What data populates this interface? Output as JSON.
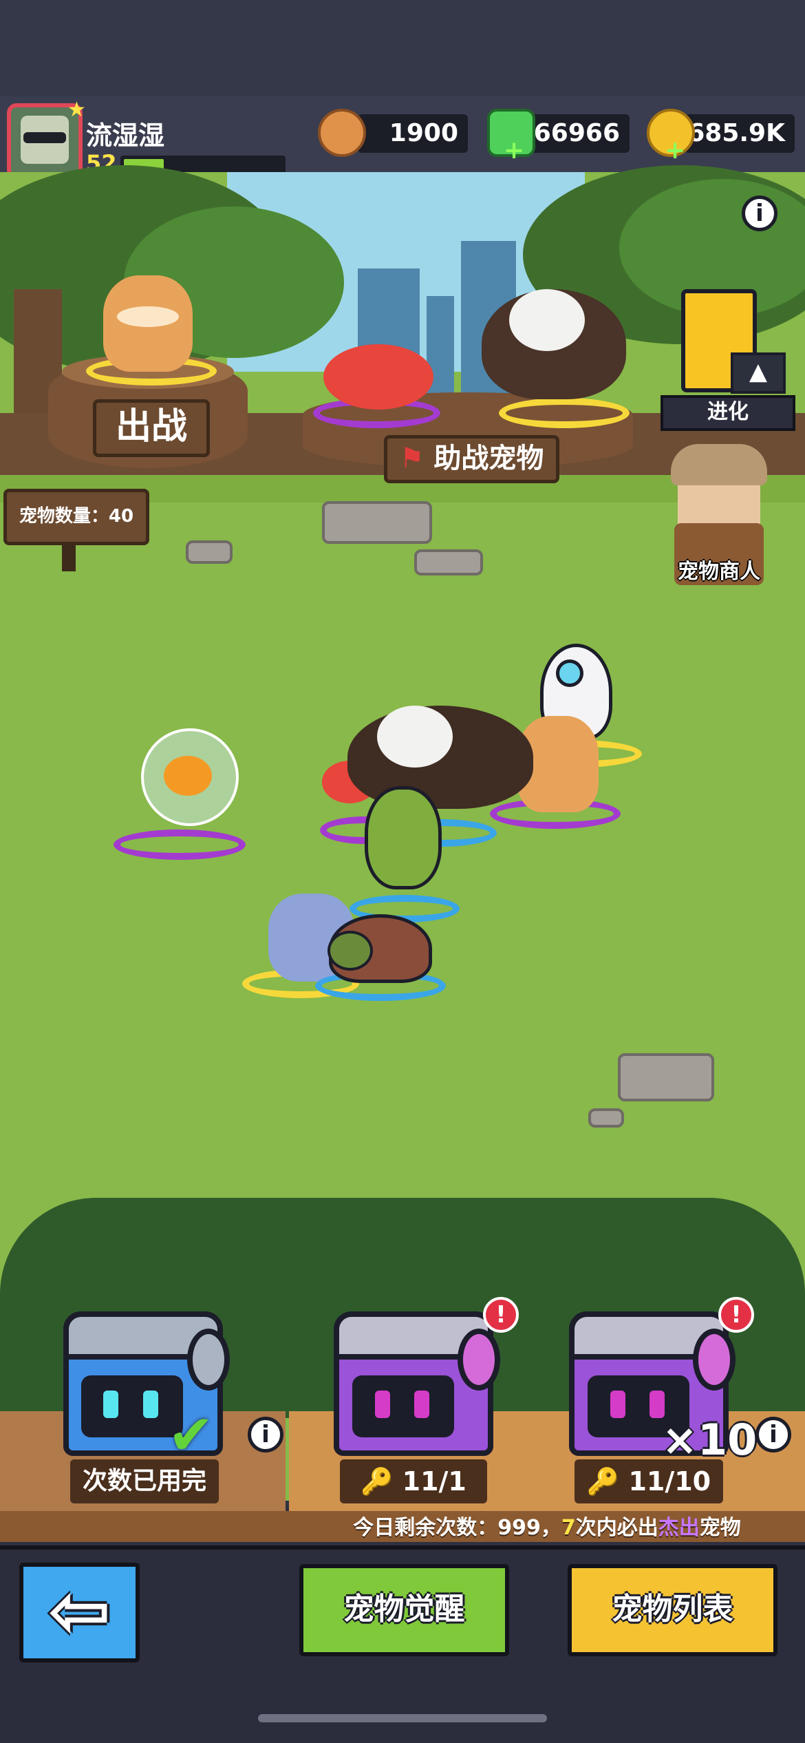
{
  "player": {
    "name": "流湿湿",
    "level": "52",
    "xp_fraction": 0.25
  },
  "resources": [
    {
      "name": "lion-coin",
      "value": "1900",
      "color": "#e0924a"
    },
    {
      "name": "green-gem",
      "value": "66966",
      "color": "#4fd05a"
    },
    {
      "name": "gold-coin",
      "value": "685.9K",
      "color": "#f3c22b"
    }
  ],
  "scene": {
    "battle_label": "出战",
    "assist_label": "助战宠物",
    "pet_count_label": "宠物数量：40",
    "evolve_label": "进化",
    "merchant_label": "宠物商人"
  },
  "chests": [
    {
      "status": "次数已用完",
      "multiplier": ""
    },
    {
      "keys": "11/1",
      "multiplier": ""
    },
    {
      "keys": "11/10",
      "multiplier": "×10"
    }
  ],
  "daily_info": {
    "prefix": "今日剩余次数：999，",
    "count": "7",
    "middle": "次内必出",
    "highlight": "杰出",
    "suffix": "宠物"
  },
  "buttons": {
    "awaken": "宠物觉醒",
    "pet_list": "宠物列表"
  },
  "icons": {
    "info": "i",
    "alert": "!"
  },
  "colors": {
    "accent_green": "#7fc93a",
    "accent_yellow": "#f5c232",
    "accent_blue": "#3fa8ee",
    "highlight_yellow": "#ffe34a",
    "highlight_purple": "#b56cf0"
  }
}
